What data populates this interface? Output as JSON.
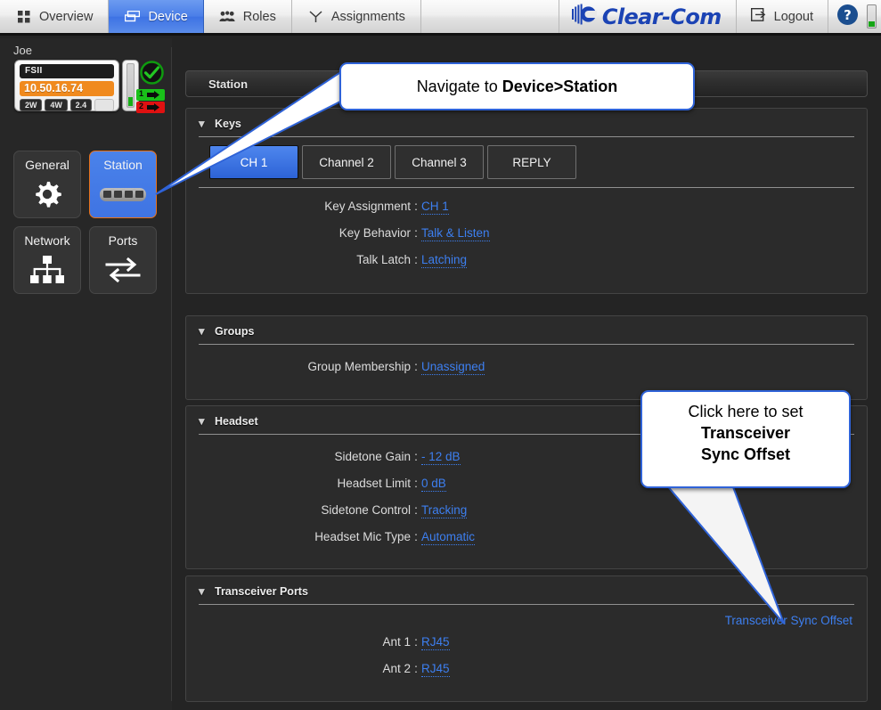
{
  "topnav": {
    "tabs": [
      {
        "label": "Overview",
        "icon": "grid-icon",
        "active": false
      },
      {
        "label": "Device",
        "icon": "device-icon",
        "active": true
      },
      {
        "label": "Roles",
        "icon": "people-icon",
        "active": false
      },
      {
        "label": "Assignments",
        "icon": "assignments-icon",
        "active": false
      }
    ],
    "brand": "Clear-Com",
    "logout_label": "Logout",
    "help_icon": "help-icon",
    "accent_blue": "#4a7ee8"
  },
  "sidebar": {
    "username": "Joe",
    "device": {
      "name": "FSII",
      "ip": "10.50.16.74",
      "chips": [
        "2W",
        "4W",
        "2.4"
      ],
      "status_icon": "check-circle-icon",
      "antennas": [
        {
          "label": "1",
          "color": "#19c119"
        },
        {
          "label": "2",
          "color": "#df1111"
        }
      ]
    },
    "tiles": [
      {
        "label": "General",
        "icon": "gear-icon",
        "selected": false
      },
      {
        "label": "Station",
        "icon": "keypad-icon",
        "selected": true
      },
      {
        "label": "Network",
        "icon": "network-tree-icon",
        "selected": false
      },
      {
        "label": "Ports",
        "icon": "arrows-exchange-icon",
        "selected": false
      }
    ]
  },
  "main": {
    "panel_title": "Station",
    "sections": [
      {
        "id": "keys",
        "title": "Keys",
        "tabs": [
          {
            "label": "CH 1",
            "selected": true
          },
          {
            "label": "Channel 2",
            "selected": false
          },
          {
            "label": "Channel 3",
            "selected": false
          },
          {
            "label": "REPLY",
            "selected": false
          }
        ],
        "rows": [
          {
            "key": "Key Assignment",
            "value": "CH 1"
          },
          {
            "key": "Key Behavior",
            "value": "Talk & Listen"
          },
          {
            "key": "Talk Latch",
            "value": "Latching"
          }
        ]
      },
      {
        "id": "groups",
        "title": "Groups",
        "rows": [
          {
            "key": "Group Membership",
            "value": "Unassigned"
          }
        ]
      },
      {
        "id": "headset",
        "title": "Headset",
        "rows": [
          {
            "key": "Sidetone Gain",
            "value": "- 12 dB"
          },
          {
            "key": "Headset Limit",
            "value": "0 dB"
          },
          {
            "key": "Sidetone Control",
            "value": "Tracking"
          },
          {
            "key": "Headset Mic Type",
            "value": "Automatic"
          }
        ]
      },
      {
        "id": "transceiver",
        "title": "Transceiver Ports",
        "link": "Transceiver Sync Offset",
        "rows": [
          {
            "key": "Ant 1",
            "value": "RJ45"
          },
          {
            "key": "Ant 2",
            "value": "RJ45"
          }
        ]
      }
    ]
  },
  "callouts": [
    {
      "id": "callout-navigate",
      "text_plain": "Navigate to ",
      "text_bold": "Device>Station"
    },
    {
      "id": "callout-sync",
      "line1": "Click here to set",
      "line2": "Transceiver",
      "line3": "Sync Offset"
    }
  ]
}
